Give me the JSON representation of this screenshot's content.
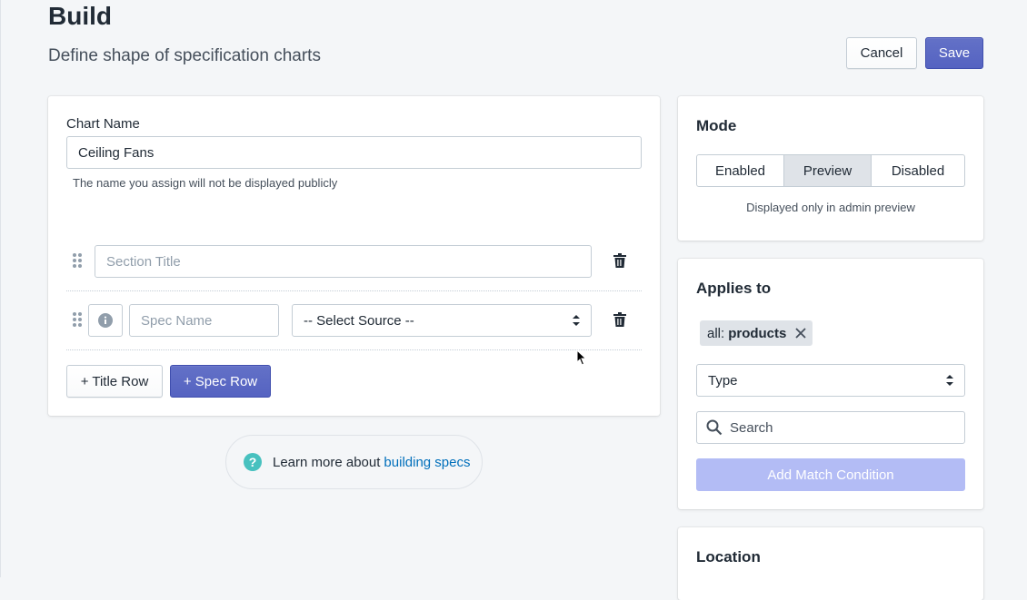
{
  "page": {
    "title": "Build",
    "subtitle": "Define shape of specification charts"
  },
  "actions": {
    "cancel_label": "Cancel",
    "save_label": "Save"
  },
  "editor": {
    "chart_name_label": "Chart Name",
    "chart_name_value": "Ceiling Fans",
    "chart_name_help": "The name you assign will not be displayed publicly",
    "section_title_placeholder": "Section Title",
    "spec_name_placeholder": "Spec Name",
    "select_source_value": "-- Select Source --",
    "title_row_button": "+ Title Row",
    "spec_row_button": "+ Spec Row"
  },
  "learn_more": {
    "prefix": "Learn more about",
    "link_text": "building specs",
    "icon": "question-circle-icon"
  },
  "mode": {
    "title": "Mode",
    "options": [
      "Enabled",
      "Preview",
      "Disabled"
    ],
    "selected": "Preview",
    "description": "Displayed only in admin preview"
  },
  "applies_to": {
    "title": "Applies to",
    "tag_prefix": "all:",
    "tag_value": "products",
    "type_select_value": "Type",
    "search_placeholder": "Search",
    "add_condition_label": "Add Match Condition"
  },
  "location": {
    "title": "Location"
  },
  "colors": {
    "primary": "#5c6ac4",
    "link": "#006fbb",
    "background": "#f4f6f8",
    "help_icon": "#47c1bf"
  }
}
